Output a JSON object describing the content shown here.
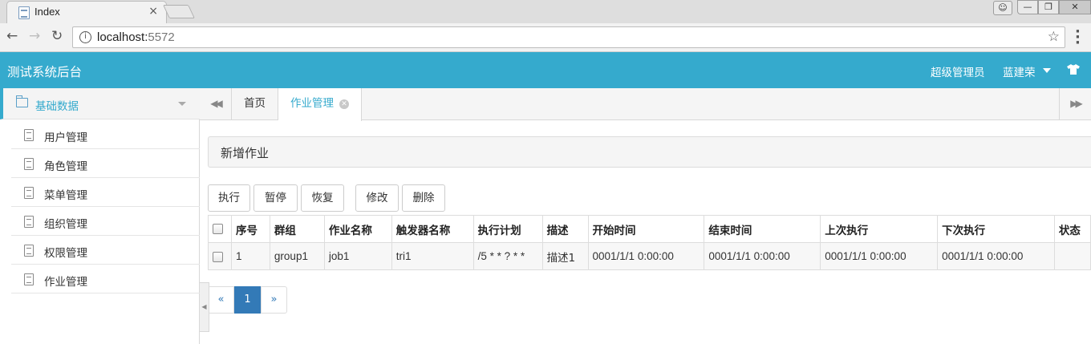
{
  "browser": {
    "tab_title": "Index",
    "tab_close": "×",
    "url_host": "localhost:",
    "url_port": "5572"
  },
  "header": {
    "title": "测试系统后台",
    "role": "超级管理员",
    "user": "蓝建荣"
  },
  "sidebar": {
    "group_label": "基础数据",
    "items": [
      {
        "label": "用户管理"
      },
      {
        "label": "角色管理"
      },
      {
        "label": "菜单管理"
      },
      {
        "label": "组织管理"
      },
      {
        "label": "权限管理"
      },
      {
        "label": "作业管理"
      }
    ]
  },
  "tabs": {
    "home": "首页",
    "active": "作业管理"
  },
  "section": {
    "title": "新增作业"
  },
  "toolbar": {
    "execute": "执行",
    "pause": "暂停",
    "resume": "恢复",
    "edit": "修改",
    "delete": "删除"
  },
  "table": {
    "headers": [
      "序号",
      "群组",
      "作业名称",
      "触发器名称",
      "执行计划",
      "描述",
      "开始时间",
      "结束时间",
      "上次执行",
      "下次执行",
      "状态"
    ],
    "rows": [
      [
        "1",
        "group1",
        "job1",
        "tri1",
        "/5 * * ? * *",
        "描述1",
        "0001/1/1 0:00:00",
        "0001/1/1 0:00:00",
        "0001/1/1 0:00:00",
        "0001/1/1 0:00:00",
        ""
      ]
    ]
  },
  "pagination": {
    "prev": "«",
    "current": "1",
    "next": "»"
  },
  "colors": {
    "header_bg": "#35aacd",
    "accent": "#35aacd",
    "pager_active": "#337ab7"
  }
}
